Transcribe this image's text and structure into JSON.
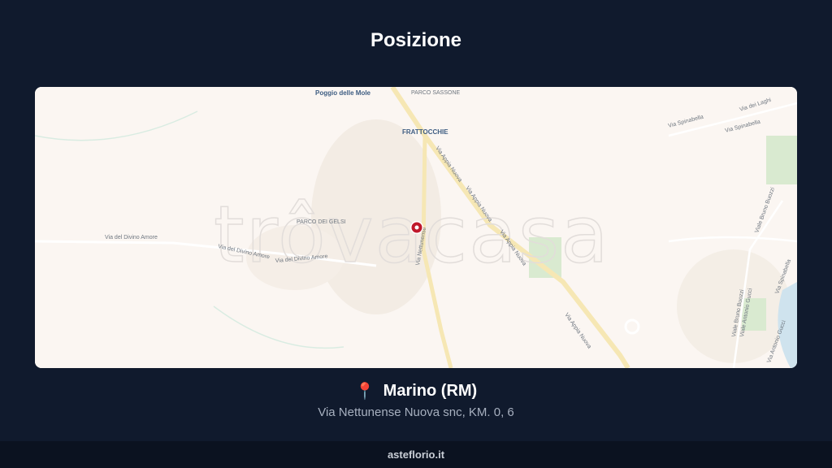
{
  "page": {
    "title": "Posizione"
  },
  "map": {
    "watermark": "trôvacasa",
    "labels": {
      "poggio": "Poggio delle Mole",
      "parco_sassone": "PARCO SASSONE",
      "frattocchie": "FRATTOCCHIE",
      "parco_gelsi": "PARCO DEI GELSI",
      "via_divino_amore_1": "Via del Divino Amore",
      "via_divino_amore_2": "Via del Divino Amore",
      "via_divino_amore_3": "Via del Divino Amore",
      "via_appia_nuova_1": "Via Appia Nuova",
      "via_appia_nuova_2": "Via Appia Nuova",
      "via_appia_nuova_3": "Via Appia Nuova",
      "via_appia_nuova_4": "Via Appia Nuova",
      "via_nettunense": "Via Nettunense",
      "via_spinabella": "Via Spinabella",
      "via_spinabella_2": "Via Spinabella",
      "via_dei_laghi": "Via dei Laghi",
      "viale_bruno_buozzi": "Viale Bruno Buozzi",
      "viale_bruno_buozzi_2": "Viale Bruno Buozzi",
      "viale_antonio_gucci": "Viale Antonio Gucci",
      "via_spinabella_3": "Via Spinabella",
      "via_antonio_gucci_2": "Via Antonio Gucci"
    },
    "marker_icon": "location-marker-icon",
    "colors": {
      "background": "#fbf6f2",
      "road_major": "#f6e7b4",
      "marker": "#c0192b",
      "park": "#d9ead0"
    }
  },
  "location": {
    "pin_icon": "📍",
    "city": "Marino (RM)",
    "address": "Via Nettunense Nuova snc, KM. 0, 6"
  },
  "footer": {
    "brand": "asteflorio.it"
  }
}
